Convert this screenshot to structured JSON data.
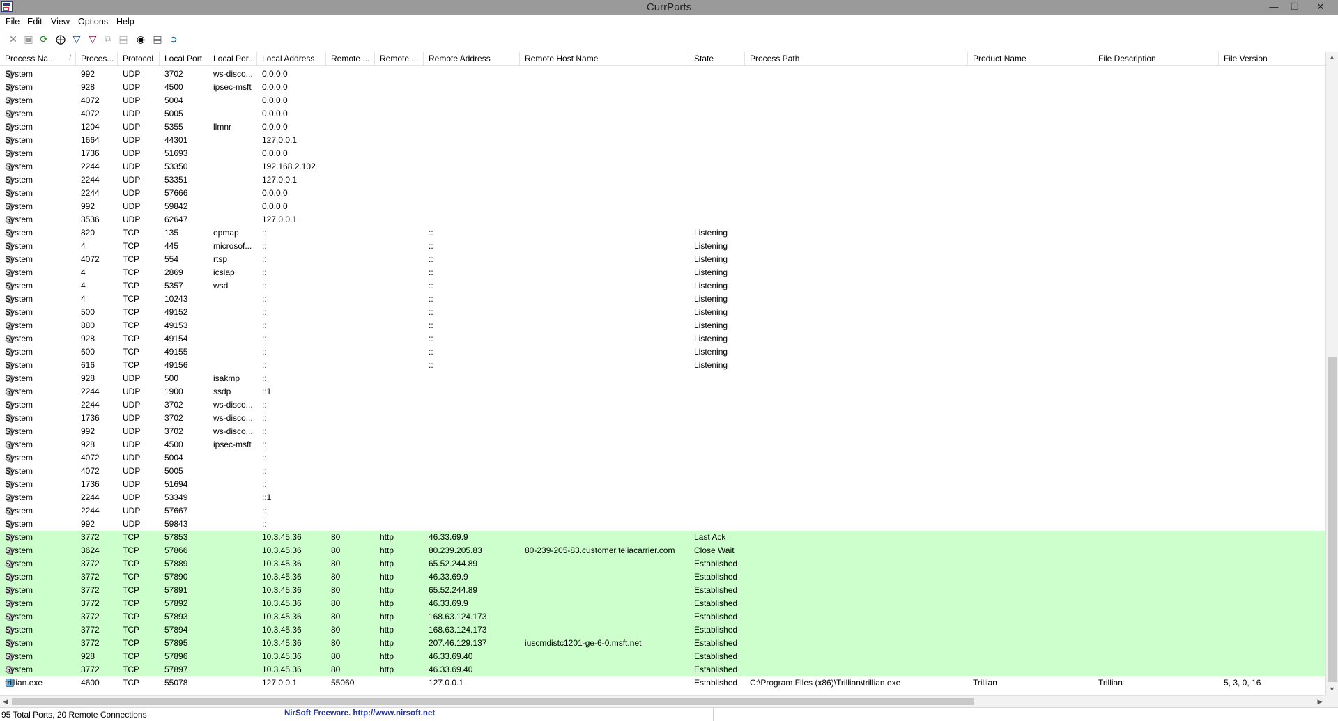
{
  "window": {
    "title": "CurrPorts"
  },
  "menu": [
    "File",
    "Edit",
    "View",
    "Options",
    "Help"
  ],
  "columns": [
    "Process Na...",
    "Proces...",
    "Protocol",
    "Local Port",
    "Local Por...",
    "Local Address",
    "Remote ...",
    "Remote ...",
    "Remote Address",
    "Remote Host Name",
    "State",
    "Process Path",
    "Product Name",
    "File Description",
    "File Version"
  ],
  "sort_indicator": "/",
  "rows": [
    {
      "p": "System",
      "pid": "992",
      "proto": "UDP",
      "lport": "3702",
      "lpn": "ws-disco...",
      "laddr": "0.0.0.0",
      "rport": "",
      "rpn": "",
      "raddr": "",
      "rhost": "",
      "state": "",
      "path": "",
      "product": "",
      "desc": "",
      "ver": "",
      "green": false
    },
    {
      "p": "System",
      "pid": "928",
      "proto": "UDP",
      "lport": "4500",
      "lpn": "ipsec-msft",
      "laddr": "0.0.0.0",
      "rport": "",
      "rpn": "",
      "raddr": "",
      "rhost": "",
      "state": "",
      "path": "",
      "product": "",
      "desc": "",
      "ver": "",
      "green": false
    },
    {
      "p": "System",
      "pid": "4072",
      "proto": "UDP",
      "lport": "5004",
      "lpn": "",
      "laddr": "0.0.0.0",
      "rport": "",
      "rpn": "",
      "raddr": "",
      "rhost": "",
      "state": "",
      "path": "",
      "product": "",
      "desc": "",
      "ver": "",
      "green": false
    },
    {
      "p": "System",
      "pid": "4072",
      "proto": "UDP",
      "lport": "5005",
      "lpn": "",
      "laddr": "0.0.0.0",
      "rport": "",
      "rpn": "",
      "raddr": "",
      "rhost": "",
      "state": "",
      "path": "",
      "product": "",
      "desc": "",
      "ver": "",
      "green": false
    },
    {
      "p": "System",
      "pid": "1204",
      "proto": "UDP",
      "lport": "5355",
      "lpn": "llmnr",
      "laddr": "0.0.0.0",
      "rport": "",
      "rpn": "",
      "raddr": "",
      "rhost": "",
      "state": "",
      "path": "",
      "product": "",
      "desc": "",
      "ver": "",
      "green": false
    },
    {
      "p": "System",
      "pid": "1664",
      "proto": "UDP",
      "lport": "44301",
      "lpn": "",
      "laddr": "127.0.0.1",
      "rport": "",
      "rpn": "",
      "raddr": "",
      "rhost": "",
      "state": "",
      "path": "",
      "product": "",
      "desc": "",
      "ver": "",
      "green": false
    },
    {
      "p": "System",
      "pid": "1736",
      "proto": "UDP",
      "lport": "51693",
      "lpn": "",
      "laddr": "0.0.0.0",
      "rport": "",
      "rpn": "",
      "raddr": "",
      "rhost": "",
      "state": "",
      "path": "",
      "product": "",
      "desc": "",
      "ver": "",
      "green": false
    },
    {
      "p": "System",
      "pid": "2244",
      "proto": "UDP",
      "lport": "53350",
      "lpn": "",
      "laddr": "192.168.2.102",
      "rport": "",
      "rpn": "",
      "raddr": "",
      "rhost": "",
      "state": "",
      "path": "",
      "product": "",
      "desc": "",
      "ver": "",
      "green": false
    },
    {
      "p": "System",
      "pid": "2244",
      "proto": "UDP",
      "lport": "53351",
      "lpn": "",
      "laddr": "127.0.0.1",
      "rport": "",
      "rpn": "",
      "raddr": "",
      "rhost": "",
      "state": "",
      "path": "",
      "product": "",
      "desc": "",
      "ver": "",
      "green": false
    },
    {
      "p": "System",
      "pid": "2244",
      "proto": "UDP",
      "lport": "57666",
      "lpn": "",
      "laddr": "0.0.0.0",
      "rport": "",
      "rpn": "",
      "raddr": "",
      "rhost": "",
      "state": "",
      "path": "",
      "product": "",
      "desc": "",
      "ver": "",
      "green": false
    },
    {
      "p": "System",
      "pid": "992",
      "proto": "UDP",
      "lport": "59842",
      "lpn": "",
      "laddr": "0.0.0.0",
      "rport": "",
      "rpn": "",
      "raddr": "",
      "rhost": "",
      "state": "",
      "path": "",
      "product": "",
      "desc": "",
      "ver": "",
      "green": false
    },
    {
      "p": "System",
      "pid": "3536",
      "proto": "UDP",
      "lport": "62647",
      "lpn": "",
      "laddr": "127.0.0.1",
      "rport": "",
      "rpn": "",
      "raddr": "",
      "rhost": "",
      "state": "",
      "path": "",
      "product": "",
      "desc": "",
      "ver": "",
      "green": false
    },
    {
      "p": "System",
      "pid": "820",
      "proto": "TCP",
      "lport": "135",
      "lpn": "epmap",
      "laddr": "::",
      "rport": "",
      "rpn": "",
      "raddr": "::",
      "rhost": "",
      "state": "Listening",
      "path": "",
      "product": "",
      "desc": "",
      "ver": "",
      "green": false
    },
    {
      "p": "System",
      "pid": "4",
      "proto": "TCP",
      "lport": "445",
      "lpn": "microsof...",
      "laddr": "::",
      "rport": "",
      "rpn": "",
      "raddr": "::",
      "rhost": "",
      "state": "Listening",
      "path": "",
      "product": "",
      "desc": "",
      "ver": "",
      "green": false
    },
    {
      "p": "System",
      "pid": "4072",
      "proto": "TCP",
      "lport": "554",
      "lpn": "rtsp",
      "laddr": "::",
      "rport": "",
      "rpn": "",
      "raddr": "::",
      "rhost": "",
      "state": "Listening",
      "path": "",
      "product": "",
      "desc": "",
      "ver": "",
      "green": false
    },
    {
      "p": "System",
      "pid": "4",
      "proto": "TCP",
      "lport": "2869",
      "lpn": "icslap",
      "laddr": "::",
      "rport": "",
      "rpn": "",
      "raddr": "::",
      "rhost": "",
      "state": "Listening",
      "path": "",
      "product": "",
      "desc": "",
      "ver": "",
      "green": false
    },
    {
      "p": "System",
      "pid": "4",
      "proto": "TCP",
      "lport": "5357",
      "lpn": "wsd",
      "laddr": "::",
      "rport": "",
      "rpn": "",
      "raddr": "::",
      "rhost": "",
      "state": "Listening",
      "path": "",
      "product": "",
      "desc": "",
      "ver": "",
      "green": false
    },
    {
      "p": "System",
      "pid": "4",
      "proto": "TCP",
      "lport": "10243",
      "lpn": "",
      "laddr": "::",
      "rport": "",
      "rpn": "",
      "raddr": "::",
      "rhost": "",
      "state": "Listening",
      "path": "",
      "product": "",
      "desc": "",
      "ver": "",
      "green": false
    },
    {
      "p": "System",
      "pid": "500",
      "proto": "TCP",
      "lport": "49152",
      "lpn": "",
      "laddr": "::",
      "rport": "",
      "rpn": "",
      "raddr": "::",
      "rhost": "",
      "state": "Listening",
      "path": "",
      "product": "",
      "desc": "",
      "ver": "",
      "green": false
    },
    {
      "p": "System",
      "pid": "880",
      "proto": "TCP",
      "lport": "49153",
      "lpn": "",
      "laddr": "::",
      "rport": "",
      "rpn": "",
      "raddr": "::",
      "rhost": "",
      "state": "Listening",
      "path": "",
      "product": "",
      "desc": "",
      "ver": "",
      "green": false
    },
    {
      "p": "System",
      "pid": "928",
      "proto": "TCP",
      "lport": "49154",
      "lpn": "",
      "laddr": "::",
      "rport": "",
      "rpn": "",
      "raddr": "::",
      "rhost": "",
      "state": "Listening",
      "path": "",
      "product": "",
      "desc": "",
      "ver": "",
      "green": false
    },
    {
      "p": "System",
      "pid": "600",
      "proto": "TCP",
      "lport": "49155",
      "lpn": "",
      "laddr": "::",
      "rport": "",
      "rpn": "",
      "raddr": "::",
      "rhost": "",
      "state": "Listening",
      "path": "",
      "product": "",
      "desc": "",
      "ver": "",
      "green": false
    },
    {
      "p": "System",
      "pid": "616",
      "proto": "TCP",
      "lport": "49156",
      "lpn": "",
      "laddr": "::",
      "rport": "",
      "rpn": "",
      "raddr": "::",
      "rhost": "",
      "state": "Listening",
      "path": "",
      "product": "",
      "desc": "",
      "ver": "",
      "green": false
    },
    {
      "p": "System",
      "pid": "928",
      "proto": "UDP",
      "lport": "500",
      "lpn": "isakmp",
      "laddr": "::",
      "rport": "",
      "rpn": "",
      "raddr": "",
      "rhost": "",
      "state": "",
      "path": "",
      "product": "",
      "desc": "",
      "ver": "",
      "green": false
    },
    {
      "p": "System",
      "pid": "2244",
      "proto": "UDP",
      "lport": "1900",
      "lpn": "ssdp",
      "laddr": "::1",
      "rport": "",
      "rpn": "",
      "raddr": "",
      "rhost": "",
      "state": "",
      "path": "",
      "product": "",
      "desc": "",
      "ver": "",
      "green": false
    },
    {
      "p": "System",
      "pid": "2244",
      "proto": "UDP",
      "lport": "3702",
      "lpn": "ws-disco...",
      "laddr": "::",
      "rport": "",
      "rpn": "",
      "raddr": "",
      "rhost": "",
      "state": "",
      "path": "",
      "product": "",
      "desc": "",
      "ver": "",
      "green": false
    },
    {
      "p": "System",
      "pid": "1736",
      "proto": "UDP",
      "lport": "3702",
      "lpn": "ws-disco...",
      "laddr": "::",
      "rport": "",
      "rpn": "",
      "raddr": "",
      "rhost": "",
      "state": "",
      "path": "",
      "product": "",
      "desc": "",
      "ver": "",
      "green": false
    },
    {
      "p": "System",
      "pid": "992",
      "proto": "UDP",
      "lport": "3702",
      "lpn": "ws-disco...",
      "laddr": "::",
      "rport": "",
      "rpn": "",
      "raddr": "",
      "rhost": "",
      "state": "",
      "path": "",
      "product": "",
      "desc": "",
      "ver": "",
      "green": false
    },
    {
      "p": "System",
      "pid": "928",
      "proto": "UDP",
      "lport": "4500",
      "lpn": "ipsec-msft",
      "laddr": "::",
      "rport": "",
      "rpn": "",
      "raddr": "",
      "rhost": "",
      "state": "",
      "path": "",
      "product": "",
      "desc": "",
      "ver": "",
      "green": false
    },
    {
      "p": "System",
      "pid": "4072",
      "proto": "UDP",
      "lport": "5004",
      "lpn": "",
      "laddr": "::",
      "rport": "",
      "rpn": "",
      "raddr": "",
      "rhost": "",
      "state": "",
      "path": "",
      "product": "",
      "desc": "",
      "ver": "",
      "green": false
    },
    {
      "p": "System",
      "pid": "4072",
      "proto": "UDP",
      "lport": "5005",
      "lpn": "",
      "laddr": "::",
      "rport": "",
      "rpn": "",
      "raddr": "",
      "rhost": "",
      "state": "",
      "path": "",
      "product": "",
      "desc": "",
      "ver": "",
      "green": false
    },
    {
      "p": "System",
      "pid": "1736",
      "proto": "UDP",
      "lport": "51694",
      "lpn": "",
      "laddr": "::",
      "rport": "",
      "rpn": "",
      "raddr": "",
      "rhost": "",
      "state": "",
      "path": "",
      "product": "",
      "desc": "",
      "ver": "",
      "green": false
    },
    {
      "p": "System",
      "pid": "2244",
      "proto": "UDP",
      "lport": "53349",
      "lpn": "",
      "laddr": "::1",
      "rport": "",
      "rpn": "",
      "raddr": "",
      "rhost": "",
      "state": "",
      "path": "",
      "product": "",
      "desc": "",
      "ver": "",
      "green": false
    },
    {
      "p": "System",
      "pid": "2244",
      "proto": "UDP",
      "lport": "57667",
      "lpn": "",
      "laddr": "::",
      "rport": "",
      "rpn": "",
      "raddr": "",
      "rhost": "",
      "state": "",
      "path": "",
      "product": "",
      "desc": "",
      "ver": "",
      "green": false
    },
    {
      "p": "System",
      "pid": "992",
      "proto": "UDP",
      "lport": "59843",
      "lpn": "",
      "laddr": "::",
      "rport": "",
      "rpn": "",
      "raddr": "",
      "rhost": "",
      "state": "",
      "path": "",
      "product": "",
      "desc": "",
      "ver": "",
      "green": false
    },
    {
      "p": "System",
      "pid": "3772",
      "proto": "TCP",
      "lport": "57853",
      "lpn": "",
      "laddr": "10.3.45.36",
      "rport": "80",
      "rpn": "http",
      "raddr": "46.33.69.9",
      "rhost": "",
      "state": "Last Ack",
      "path": "",
      "product": "",
      "desc": "",
      "ver": "",
      "green": true
    },
    {
      "p": "System",
      "pid": "3624",
      "proto": "TCP",
      "lport": "57866",
      "lpn": "",
      "laddr": "10.3.45.36",
      "rport": "80",
      "rpn": "http",
      "raddr": "80.239.205.83",
      "rhost": "80-239-205-83.customer.teliacarrier.com",
      "state": "Close Wait",
      "path": "",
      "product": "",
      "desc": "",
      "ver": "",
      "green": true
    },
    {
      "p": "System",
      "pid": "3772",
      "proto": "TCP",
      "lport": "57889",
      "lpn": "",
      "laddr": "10.3.45.36",
      "rport": "80",
      "rpn": "http",
      "raddr": "65.52.244.89",
      "rhost": "",
      "state": "Established",
      "path": "",
      "product": "",
      "desc": "",
      "ver": "",
      "green": true
    },
    {
      "p": "System",
      "pid": "3772",
      "proto": "TCP",
      "lport": "57890",
      "lpn": "",
      "laddr": "10.3.45.36",
      "rport": "80",
      "rpn": "http",
      "raddr": "46.33.69.9",
      "rhost": "",
      "state": "Established",
      "path": "",
      "product": "",
      "desc": "",
      "ver": "",
      "green": true
    },
    {
      "p": "System",
      "pid": "3772",
      "proto": "TCP",
      "lport": "57891",
      "lpn": "",
      "laddr": "10.3.45.36",
      "rport": "80",
      "rpn": "http",
      "raddr": "65.52.244.89",
      "rhost": "",
      "state": "Established",
      "path": "",
      "product": "",
      "desc": "",
      "ver": "",
      "green": true
    },
    {
      "p": "System",
      "pid": "3772",
      "proto": "TCP",
      "lport": "57892",
      "lpn": "",
      "laddr": "10.3.45.36",
      "rport": "80",
      "rpn": "http",
      "raddr": "46.33.69.9",
      "rhost": "",
      "state": "Established",
      "path": "",
      "product": "",
      "desc": "",
      "ver": "",
      "green": true
    },
    {
      "p": "System",
      "pid": "3772",
      "proto": "TCP",
      "lport": "57893",
      "lpn": "",
      "laddr": "10.3.45.36",
      "rport": "80",
      "rpn": "http",
      "raddr": "168.63.124.173",
      "rhost": "",
      "state": "Established",
      "path": "",
      "product": "",
      "desc": "",
      "ver": "",
      "green": true
    },
    {
      "p": "System",
      "pid": "3772",
      "proto": "TCP",
      "lport": "57894",
      "lpn": "",
      "laddr": "10.3.45.36",
      "rport": "80",
      "rpn": "http",
      "raddr": "168.63.124.173",
      "rhost": "",
      "state": "Established",
      "path": "",
      "product": "",
      "desc": "",
      "ver": "",
      "green": true
    },
    {
      "p": "System",
      "pid": "3772",
      "proto": "TCP",
      "lport": "57895",
      "lpn": "",
      "laddr": "10.3.45.36",
      "rport": "80",
      "rpn": "http",
      "raddr": "207.46.129.137",
      "rhost": "iuscmdistc1201-ge-6-0.msft.net",
      "state": "Established",
      "path": "",
      "product": "",
      "desc": "",
      "ver": "",
      "green": true
    },
    {
      "p": "System",
      "pid": "928",
      "proto": "TCP",
      "lport": "57896",
      "lpn": "",
      "laddr": "10.3.45.36",
      "rport": "80",
      "rpn": "http",
      "raddr": "46.33.69.40",
      "rhost": "",
      "state": "Established",
      "path": "",
      "product": "",
      "desc": "",
      "ver": "",
      "green": true
    },
    {
      "p": "System",
      "pid": "3772",
      "proto": "TCP",
      "lport": "57897",
      "lpn": "",
      "laddr": "10.3.45.36",
      "rport": "80",
      "rpn": "http",
      "raddr": "46.33.69.40",
      "rhost": "",
      "state": "Established",
      "path": "",
      "product": "",
      "desc": "",
      "ver": "",
      "green": true
    },
    {
      "p": "trillian.exe",
      "pid": "4600",
      "proto": "TCP",
      "lport": "55078",
      "lpn": "",
      "laddr": "127.0.0.1",
      "rport": "55060",
      "rpn": "",
      "raddr": "127.0.0.1",
      "rhost": "",
      "state": "Established",
      "path": "C:\\Program Files (x86)\\Trillian\\trillian.exe",
      "product": "Trillian",
      "desc": "Trillian",
      "ver": "5, 3, 0, 16",
      "green": false,
      "app": true
    }
  ],
  "status": {
    "summary": "95 Total Ports, 20 Remote Connections",
    "freeware": "NirSoft Freeware.  http://www.nirsoft.net"
  },
  "icons": [
    "close-icon",
    "save-icon",
    "refresh-icon",
    "properties-icon",
    "filter-icon",
    "filter-add-icon",
    "copy-icon",
    "html-report-icon",
    "find-icon",
    "report-icon",
    "exit-icon"
  ]
}
